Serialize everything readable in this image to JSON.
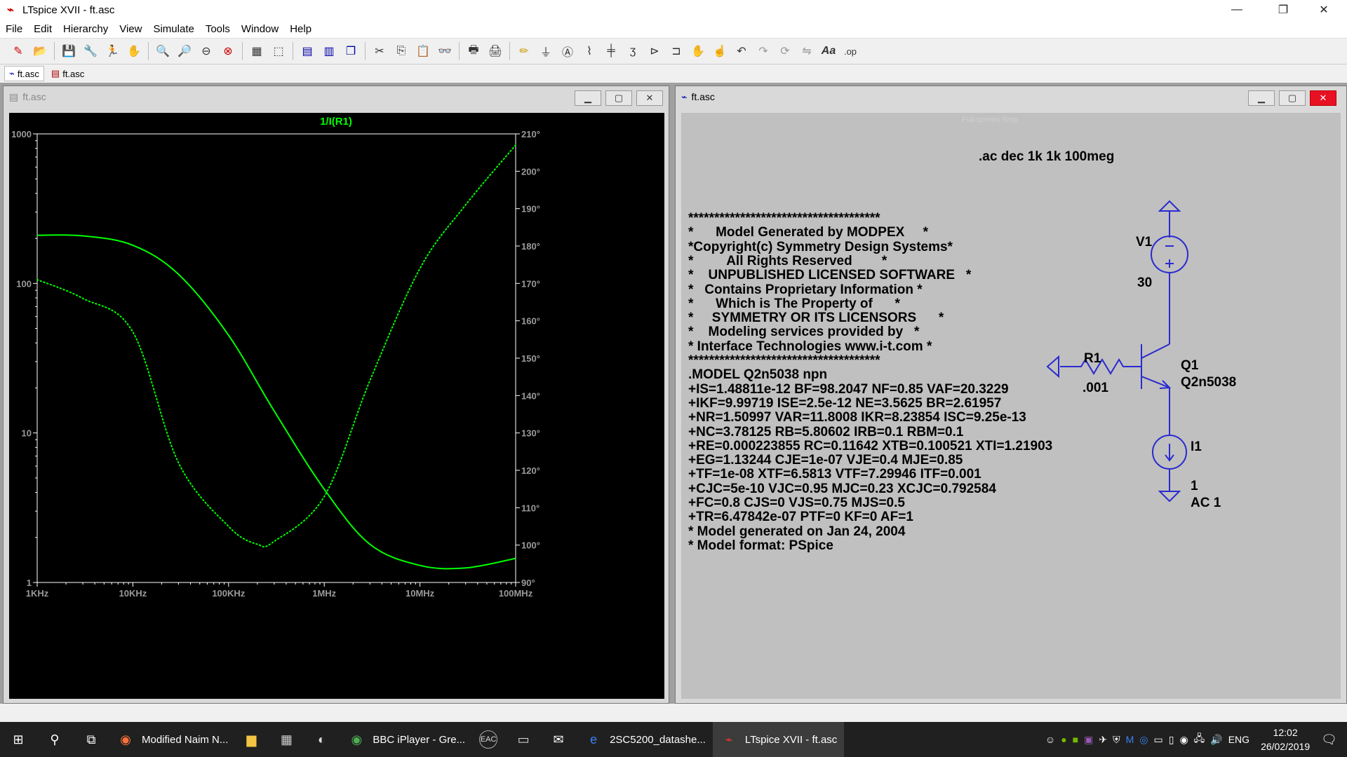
{
  "app": {
    "title": "LTspice XVII - ft.asc",
    "window_controls": {
      "minimize": "—",
      "maximize": "❐",
      "close": "✕"
    }
  },
  "menu": [
    "File",
    "Edit",
    "Hierarchy",
    "View",
    "Simulate",
    "Tools",
    "Window",
    "Help"
  ],
  "toolbar_icons": [
    "new-schematic-icon",
    "open-icon",
    "save-icon",
    "control-panel-icon",
    "run-icon",
    "halt-icon",
    "zoom-in-icon",
    "zoom-pan-icon",
    "zoom-out-icon",
    "zoom-fit-icon",
    "autorange-icon",
    "grid-icon",
    "tile-horizontal-icon",
    "tile-vertical-icon",
    "cascade-icon",
    "cut-icon",
    "copy-icon",
    "paste-icon",
    "find-icon",
    "print-icon",
    "print-setup-icon",
    "pencil-icon",
    "ground-icon",
    "label-icon",
    "resistor-icon",
    "capacitor-icon",
    "inductor-icon",
    "diode-icon",
    "component-icon",
    "move-icon",
    "drag-icon",
    "undo-icon",
    "redo-icon",
    "rotate-icon",
    "mirror-icon",
    "text-icon",
    "spice-directive-icon"
  ],
  "tabs": [
    {
      "label": "ft.asc",
      "icon": "schematic-icon"
    },
    {
      "label": "ft.asc",
      "icon": "waveform-icon"
    }
  ],
  "wave_window": {
    "title": "ft.asc",
    "trace_label": "1/I(R1)",
    "trace_color": "#00ff00",
    "left_ticks": [
      "1000",
      "100",
      "10",
      "1"
    ],
    "right_ticks": [
      "210°",
      "200°",
      "190°",
      "180°",
      "170°",
      "160°",
      "150°",
      "140°",
      "130°",
      "120°",
      "110°",
      "100°",
      "90°"
    ],
    "x_ticks": [
      "1KHz",
      "10KHz",
      "100KHz",
      "1MHz",
      "10MHz",
      "100MHz"
    ]
  },
  "chart_data": {
    "type": "line",
    "xscale": "log",
    "yscale_left": "log",
    "xlim": [
      1000,
      100000000
    ],
    "ylim_left": [
      1,
      1000
    ],
    "ylim_right": [
      90,
      210
    ],
    "series": [
      {
        "name": "1/I(R1)",
        "axis": "left",
        "style": "solid",
        "color": "#00ff00",
        "x": [
          1000,
          3000,
          10000,
          30000,
          100000,
          300000,
          1000000,
          3000000,
          10000000,
          30000000,
          100000000
        ],
        "y": [
          210,
          208,
          180,
          115,
          45,
          14,
          4.2,
          1.8,
          1.3,
          1.25,
          1.45
        ]
      },
      {
        "axis": "right",
        "style": "dotted",
        "color": "#00ff00",
        "x": [
          1000,
          3000,
          10000,
          30000,
          100000,
          200000,
          300000,
          1000000,
          3000000,
          10000000,
          30000000,
          100000000
        ],
        "y": [
          171,
          166,
          157,
          122,
          105,
          100.2,
          101,
          113,
          144,
          174,
          191,
          207
        ]
      }
    ]
  },
  "sch_window": {
    "title": "ft.asc",
    "faint_text": "Full-screen Snip",
    "directive": ".ac dec 1k 1k 100meg",
    "model_lines": [
      "*************************************",
      "*      Model Generated by MODPEX     *",
      "*Copyright(c) Symmetry Design Systems*",
      "*         All Rights Reserved        *",
      "*    UNPUBLISHED LICENSED SOFTWARE   *",
      "*   Contains Proprietary Information *",
      "*      Which is The Property of      *",
      "*     SYMMETRY OR ITS LICENSORS      *",
      "*    Modeling services provided by   *",
      "* Interface Technologies www.i-t.com *",
      "*************************************",
      ".MODEL Q2n5038 npn",
      "+IS=1.48811e-12 BF=98.2047 NF=0.85 VAF=20.3229",
      "+IKF=9.99719 ISE=2.5e-12 NE=3.5625 BR=2.61957",
      "+NR=1.50997 VAR=11.8008 IKR=8.23854 ISC=9.25e-13",
      "+NC=3.78125 RB=5.80602 IRB=0.1 RBM=0.1",
      "+RE=0.000223855 RC=0.11642 XTB=0.100521 XTI=1.21903",
      "+EG=1.13244 CJE=1e-07 VJE=0.4 MJE=0.85",
      "+TF=1e-08 XTF=6.5813 VTF=7.29946 ITF=0.001",
      "+CJC=5e-10 VJC=0.95 MJC=0.23 XCJC=0.792584",
      "+FC=0.8 CJS=0 VJS=0.75 MJS=0.5",
      "+TR=6.47842e-07 PTF=0 KF=0 AF=1",
      "* Model generated on Jan 24, 2004",
      "* Model format: PSpice"
    ],
    "v1": {
      "name": "V1",
      "value": "30"
    },
    "r1": {
      "name": "R1",
      "value": ".001"
    },
    "q1": {
      "name": "Q1",
      "model": "Q2n5038"
    },
    "i1": {
      "name": "I1",
      "value": "1",
      "ac": "AC 1"
    },
    "wire_color": "#2a2ad0"
  },
  "taskbar": {
    "items": [
      {
        "label": "Modified Naim N...",
        "icon": "firefox-icon"
      },
      {
        "label": "",
        "icon": "file-explorer-icon"
      },
      {
        "label": "",
        "icon": "calculator-icon"
      },
      {
        "label": "",
        "icon": "app-icon"
      },
      {
        "label": "BBC iPlayer - Gre...",
        "icon": "chrome-icon"
      },
      {
        "label": "EAC",
        "icon": "eac-icon"
      },
      {
        "label": "",
        "icon": "terminal-icon"
      },
      {
        "label": "",
        "icon": "mail-icon"
      },
      {
        "label": "2SC5200_datashe...",
        "icon": "edge-icon"
      },
      {
        "label": "LTspice XVII - ft.asc",
        "icon": "ltspice-icon",
        "active": true
      }
    ],
    "language": "ENG",
    "time": "12:02",
    "date": "26/02/2019"
  }
}
